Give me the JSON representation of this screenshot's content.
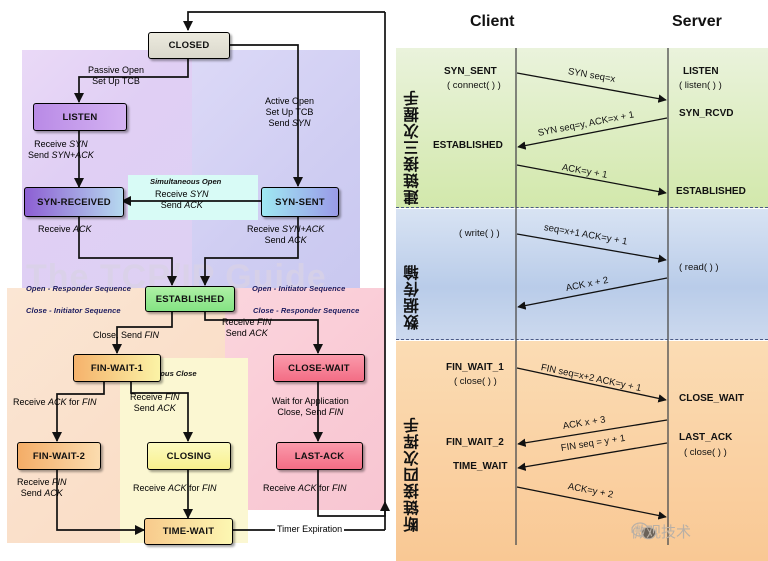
{
  "left_diagram": {
    "title_watermark": "The TCP/IP Guide",
    "regions": [
      {
        "name": "open-responder",
        "label": "Open - Responder Sequence"
      },
      {
        "name": "open-initiator",
        "label": "Open - Initiator Sequence"
      },
      {
        "name": "close-initiator",
        "label": "Close - Initiator Sequence"
      },
      {
        "name": "close-responder",
        "label": "Close - Responder Sequence"
      },
      {
        "name": "simultaneous-open",
        "label": "Simultaneous Open"
      },
      {
        "name": "simultaneous-close",
        "label": "Simultaneous Close"
      }
    ],
    "states": [
      {
        "id": "closed",
        "label": "CLOSED"
      },
      {
        "id": "listen",
        "label": "LISTEN"
      },
      {
        "id": "syn-sent",
        "label": "SYN-SENT"
      },
      {
        "id": "syn-received",
        "label": "SYN-RECEIVED"
      },
      {
        "id": "established",
        "label": "ESTABLISHED"
      },
      {
        "id": "fin-wait-1",
        "label": "FIN-WAIT-1"
      },
      {
        "id": "fin-wait-2",
        "label": "FIN-WAIT-2"
      },
      {
        "id": "closing",
        "label": "CLOSING"
      },
      {
        "id": "close-wait",
        "label": "CLOSE-WAIT"
      },
      {
        "id": "last-ack",
        "label": "LAST-ACK"
      },
      {
        "id": "time-wait",
        "label": "TIME-WAIT"
      }
    ],
    "transitions": [
      {
        "id": "passive-open",
        "line1": "Passive Open",
        "line2": "Set Up TCB",
        "line3": ""
      },
      {
        "id": "active-open",
        "line1": "Active Open",
        "line2": "Set Up TCB",
        "line3": "Send SYN"
      },
      {
        "id": "listen-to-synrcvd",
        "line1": "Receive SYN",
        "line2": "Send SYN+ACK",
        "line3": ""
      },
      {
        "id": "simopen",
        "line1": "Receive SYN",
        "line2": "Send ACK",
        "line3": ""
      },
      {
        "id": "synrcvd-to-est",
        "line1": "Receive ACK",
        "line2": "",
        "line3": ""
      },
      {
        "id": "synsent-to-est",
        "line1": "Receive SYN+ACK",
        "line2": "Send ACK",
        "line3": ""
      },
      {
        "id": "est-to-finwait1",
        "line1": "Close, Send FIN",
        "line2": "",
        "line3": ""
      },
      {
        "id": "est-to-closewait",
        "line1": "Receive FIN",
        "line2": "Send ACK",
        "line3": ""
      },
      {
        "id": "finwait1-to-finwait2",
        "line1": "Receive ACK for FIN",
        "line2": "",
        "line3": ""
      },
      {
        "id": "finwait1-to-closing",
        "line1": "Receive FIN",
        "line2": "Send ACK",
        "line3": ""
      },
      {
        "id": "closewait-to-lastack",
        "line1": "Wait for Application",
        "line2": "Close, Send FIN",
        "line3": ""
      },
      {
        "id": "finwait2-to-timewait",
        "line1": "Receive FIN",
        "line2": "Send ACK",
        "line3": ""
      },
      {
        "id": "closing-to-timewait",
        "line1": "Receive ACK for FIN",
        "line2": "",
        "line3": ""
      },
      {
        "id": "lastack-to-closed",
        "line1": "Receive ACK for FIN",
        "line2": "",
        "line3": ""
      },
      {
        "id": "timewait-to-closed",
        "line1": "Timer Expiration",
        "line2": "",
        "line3": ""
      }
    ]
  },
  "right_diagram": {
    "parties": {
      "client": "Client",
      "server": "Server"
    },
    "bands": [
      {
        "id": "handshake",
        "vertical_label": "建链接三次握手"
      },
      {
        "id": "data-transfer",
        "vertical_label": "数据传输"
      },
      {
        "id": "teardown",
        "vertical_label": "断链接四次挥手"
      }
    ],
    "handshake": {
      "client_states": [
        {
          "state": "SYN_SENT",
          "call": "( connect( ) )"
        },
        {
          "state": "ESTABLISHED",
          "call": ""
        }
      ],
      "server_states": [
        {
          "state": "LISTEN",
          "call": "( listen( ) )"
        },
        {
          "state": "SYN_RCVD",
          "call": ""
        },
        {
          "state": "ESTABLISHED",
          "call": ""
        }
      ],
      "messages": [
        {
          "text": "SYN seq=x",
          "dir": "c2s"
        },
        {
          "text": "SYN seq=y, ACK=x + 1",
          "dir": "s2c"
        },
        {
          "text": "ACK=y + 1",
          "dir": "c2s"
        }
      ]
    },
    "data_transfer": {
      "client_states": [
        {
          "state": "",
          "call": "( write( ) )"
        }
      ],
      "server_states": [
        {
          "state": "",
          "call": "( read( ) )"
        }
      ],
      "messages": [
        {
          "text": "seq=x+1 ACK=y + 1",
          "dir": "c2s"
        },
        {
          "text": "ACK x + 2",
          "dir": "s2c"
        }
      ]
    },
    "teardown": {
      "client_states": [
        {
          "state": "FIN_WAIT_1",
          "call": "( close( ) )"
        },
        {
          "state": "FIN_WAIT_2",
          "call": ""
        },
        {
          "state": "TIME_WAIT",
          "call": ""
        }
      ],
      "server_states": [
        {
          "state": "CLOSE_WAIT",
          "call": ""
        },
        {
          "state": "LAST_ACK",
          "call": "( close( ) )"
        }
      ],
      "messages": [
        {
          "text": "FIN seq=x+2 ACK=y + 1",
          "dir": "c2s"
        },
        {
          "text": "ACK x + 3",
          "dir": "s2c"
        },
        {
          "text": "FIN seq = y + 1",
          "dir": "s2c"
        },
        {
          "text": "ACK=y + 2",
          "dir": "c2s"
        }
      ]
    },
    "watermark": "微观技术"
  },
  "colors": {
    "region_open_responder": "#e3d4f2",
    "region_open_initiator": "#ccccf2",
    "region_close_initiator": "#fbe2cd",
    "region_close_responder": "#f9ccd6",
    "region_sim_open": "#d6fbf7",
    "region_sim_close": "#fbf6cd",
    "band_handshake": "#dcecc2",
    "band_data": "#c3d3ec",
    "band_teardown": "#fbd2a3",
    "closed_box": "#dedcd2",
    "listen_box": "#c49ae8",
    "syn_received_box": "#9b6fd6",
    "syn_sent_box": "#9fe7ef",
    "established_box": "#98ec98",
    "fin_wait_box": "#f7c185",
    "closing_box": "#fbf7a8",
    "close_wait_box": "#f58699",
    "time_wait_box": "#f8c98a"
  }
}
